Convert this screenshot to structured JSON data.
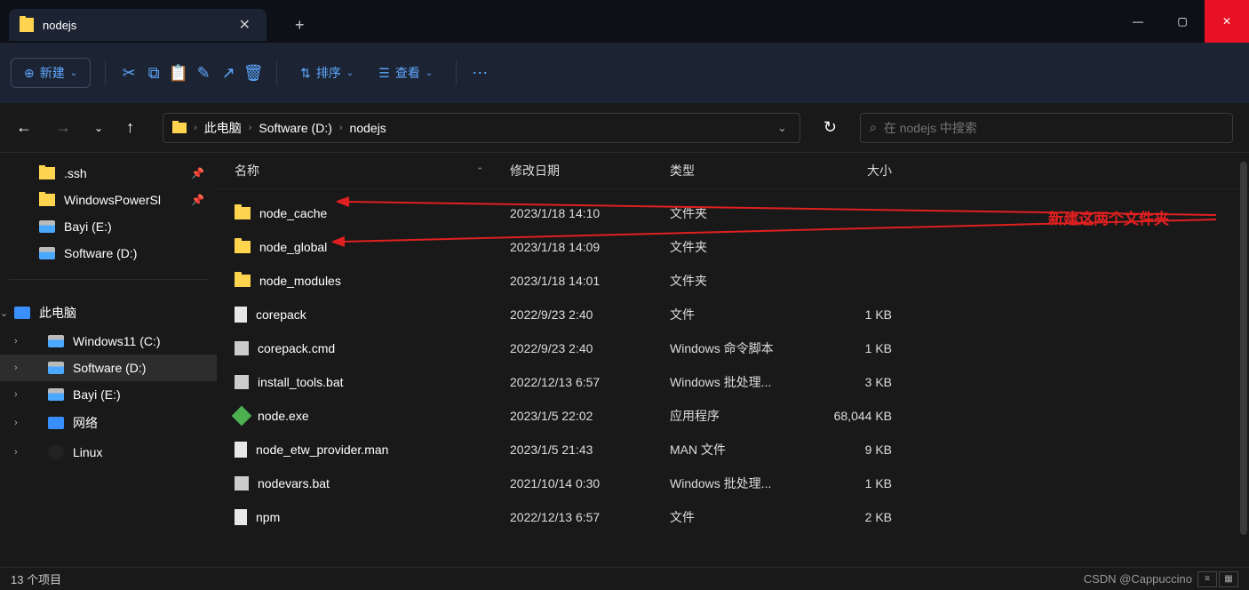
{
  "window": {
    "tab_title": "nodejs",
    "minimize": "—",
    "maximize": "▢",
    "close": "✕"
  },
  "toolbar": {
    "new_label": "新建",
    "sort_label": "排序",
    "view_label": "查看"
  },
  "breadcrumb": {
    "items": [
      "此电脑",
      "Software (D:)",
      "nodejs"
    ]
  },
  "search": {
    "placeholder": "在 nodejs 中搜索"
  },
  "sidebar": {
    "quick": [
      {
        "label": ".ssh",
        "icon": "folder",
        "pinned": true
      },
      {
        "label": "WindowsPowerSl",
        "icon": "folder",
        "pinned": true
      },
      {
        "label": "Bayi (E:)",
        "icon": "drive",
        "pinned": false
      },
      {
        "label": "Software (D:)",
        "icon": "drive",
        "pinned": false
      }
    ],
    "pc_label": "此电脑",
    "drives": [
      {
        "label": "Windows11 (C:)",
        "icon": "drive",
        "selected": false
      },
      {
        "label": "Software (D:)",
        "icon": "drive",
        "selected": true
      },
      {
        "label": "Bayi (E:)",
        "icon": "drive",
        "selected": false
      }
    ],
    "network_label": "网络",
    "linux_label": "Linux"
  },
  "columns": {
    "name": "名称",
    "date": "修改日期",
    "type": "类型",
    "size": "大小"
  },
  "files": [
    {
      "name": "node_cache",
      "date": "2023/1/18 14:10",
      "type": "文件夹",
      "size": "",
      "icon": "folder"
    },
    {
      "name": "node_global",
      "date": "2023/1/18 14:09",
      "type": "文件夹",
      "size": "",
      "icon": "folder"
    },
    {
      "name": "node_modules",
      "date": "2023/1/18 14:01",
      "type": "文件夹",
      "size": "",
      "icon": "folder"
    },
    {
      "name": "corepack",
      "date": "2022/9/23 2:40",
      "type": "文件",
      "size": "1 KB",
      "icon": "file"
    },
    {
      "name": "corepack.cmd",
      "date": "2022/9/23 2:40",
      "type": "Windows 命令脚本",
      "size": "1 KB",
      "icon": "cmd"
    },
    {
      "name": "install_tools.bat",
      "date": "2022/12/13 6:57",
      "type": "Windows 批处理...",
      "size": "3 KB",
      "icon": "cmd"
    },
    {
      "name": "node.exe",
      "date": "2023/1/5 22:02",
      "type": "应用程序",
      "size": "68,044 KB",
      "icon": "exe"
    },
    {
      "name": "node_etw_provider.man",
      "date": "2023/1/5 21:43",
      "type": "MAN 文件",
      "size": "9 KB",
      "icon": "file"
    },
    {
      "name": "nodevars.bat",
      "date": "2021/10/14 0:30",
      "type": "Windows 批处理...",
      "size": "1 KB",
      "icon": "cmd"
    },
    {
      "name": "npm",
      "date": "2022/12/13 6:57",
      "type": "文件",
      "size": "2 KB",
      "icon": "file"
    }
  ],
  "annotation": {
    "text": "新建这两个文件夹"
  },
  "status": {
    "count": "13 个项目",
    "watermark": "CSDN @Cappuccino"
  }
}
